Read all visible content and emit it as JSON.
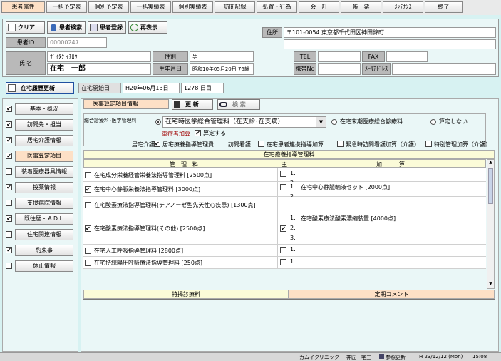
{
  "tabs": [
    "患者属性",
    "一括予定表",
    "個別予定表",
    "一括実績表",
    "個別実績表",
    "訪問記録",
    "処置・行為",
    "会　計",
    "帳　票",
    "ﾒﾝﾃﾅﾝｽ",
    "終了"
  ],
  "toolbar": {
    "clear": "クリア",
    "search": "患者検索",
    "register": "患者登録",
    "redisplay": "再表示"
  },
  "patient": {
    "id_label": "患者ID",
    "id_value": "00000247",
    "name_label": "氏 名",
    "kana": "ｻﾞｲﾀｸ ｲﾁﾛｳ",
    "name": "在宅　一郎",
    "sex_label": "性別",
    "sex": "男",
    "dob_label": "生年月日",
    "dob": "昭和10年05月20日",
    "age": "76歳",
    "addr_label": "住所",
    "address": "〒101-0054 東京都千代田区神田錦町",
    "tel_label": "TEL",
    "fax_label": "FAX",
    "mobile_label": "携帯No",
    "email_label": "ﾒｰﾙｱﾄﾞﾚｽ"
  },
  "history": {
    "update_btn": "在宅履歴更新",
    "start_label": "在宅開始日",
    "start_date": "H20年06月13日",
    "days": "1278 日目"
  },
  "sidebar": [
    {
      "label": "基本・概況",
      "checked": true
    },
    {
      "label": "訪問先・担当",
      "checked": true
    },
    {
      "label": "居宅介護情報",
      "checked": true
    },
    {
      "label": "医事算定項目",
      "checked": true
    },
    {
      "label": "装着医療器具情報",
      "checked": false
    },
    {
      "label": "投薬情報",
      "checked": true
    },
    {
      "label": "支援病院情報",
      "checked": false
    },
    {
      "label": "既往歴・ＡＤＬ",
      "checked": true
    },
    {
      "label": "住宅関連情報",
      "checked": false
    },
    {
      "label": "約束事",
      "checked": true
    },
    {
      "label": "休止情報",
      "checked": false
    }
  ],
  "panel": {
    "title": "医事算定項目情報",
    "update": "更 新",
    "search": "検 索",
    "sogo_label": "総合診療料･医学管理料",
    "sogo_select": "在宅時医学総合管理料（在支診･在支病）",
    "opt_terminal": "在宅末期医療総合診療料",
    "opt_none": "算定しない",
    "juusho": "重症者加算",
    "santei": "算定する",
    "kyotaku_label": "居宅介護",
    "kyotaku_item": "居宅療養指導管理費",
    "houmon_label": "訪問看護",
    "c1": "在宅患者連携指導加算",
    "c2": "緊急時訪問看護加算（介護）",
    "c3": "特別管理加算（介護）"
  },
  "table": {
    "caption": "在宅療養指導管理料",
    "h_kanri": "管　理　料",
    "h_main": "主",
    "h_kasan": "加　　　算",
    "rows": [
      {
        "name": "在宅成分栄養経管栄養法指導管理料 [2500点]",
        "checked": false,
        "main": false,
        "n": [
          "1.",
          "2."
        ],
        "k": [
          "",
          ""
        ]
      },
      {
        "name": "在宅中心静脈栄養法指導管理料 [3000点]",
        "checked": true,
        "main": false,
        "n": [
          "1.",
          "2."
        ],
        "k": [
          "在宅中心静脈輸液セット [2000点]",
          ""
        ]
      },
      {
        "name": "在宅酸素療法指導管理料(チアノーゼ型先天性心疾患) [1300点]",
        "checked": false,
        "main": false,
        "n": [],
        "k": []
      },
      {
        "name": "在宅酸素療法指導管理料(その他) [2500点]",
        "checked": true,
        "main": true,
        "n": [
          "1.",
          "2.",
          "3."
        ],
        "k": [
          "在宅酸素療法酸素濃縮装置 [4000点]",
          "",
          ""
        ]
      },
      {
        "name": "在宅人工呼吸指導管理料 [2800点]",
        "checked": false,
        "main": false,
        "n": [
          "1."
        ],
        "k": [
          ""
        ]
      },
      {
        "name": "在宅持続陽圧呼吸療法指導管理料 [250点]",
        "checked": false,
        "main": false,
        "n": [
          "1."
        ],
        "k": [
          ""
        ]
      }
    ]
  },
  "footer": {
    "tab1": "特掲診療料",
    "tab2": "定期コメント"
  },
  "status": {
    "clinic": "カムイクリニック",
    "user": "神匠　宅三",
    "ref": "参照更新",
    "date": "H 23/12/12 (Mon)",
    "time": "15:08"
  }
}
